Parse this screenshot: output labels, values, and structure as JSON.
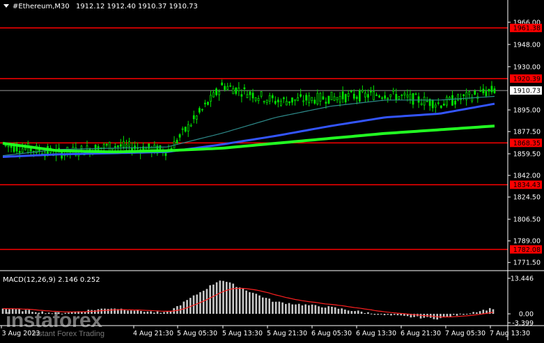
{
  "header": {
    "symbol": "#Ethereum,M30",
    "ohlc": "1912.12 1912.40 1910.37 1910.73"
  },
  "price_axis": {
    "ticks": [
      "1966.00",
      "1948.00",
      "1930.00",
      "1895.00",
      "1877.50",
      "1859.50",
      "1842.00",
      "1824.50",
      "1806.50",
      "1789.00",
      "1771.50"
    ],
    "current_price": "1910.73"
  },
  "levels": [
    "1961.38",
    "1920.39",
    "1868.35",
    "1834.43",
    "1782.08"
  ],
  "time_axis": [
    "3 Aug 2023",
    "4 Aug 21:30",
    "5 Aug 05:30",
    "5 Aug 13:30",
    "5 Aug 21:30",
    "6 Aug 05:30",
    "6 Aug 13:30",
    "6 Aug 21:30",
    "7 Aug 05:30",
    "7 Aug 13:30"
  ],
  "macd": {
    "label": "MACD(12,26,9) 2.146 0.252",
    "ticks": [
      "13.446",
      "0.00",
      "-3.399"
    ]
  },
  "watermark": {
    "name": "instaforex",
    "tagline": "Instant Forex Trading"
  },
  "colors": {
    "background": "#000000",
    "candle": "#00e000",
    "level_line": "#ff0000",
    "level_label_bg": "#ff0000",
    "ma_fast": "#2e8b8b",
    "ma_mid": "#3355ff",
    "ma_slow": "#22ff22",
    "macd_hist": "#c8c8c8",
    "macd_signal": "#ff2020",
    "axis_text": "#ffffff"
  },
  "chart_data": {
    "type": "line",
    "title": "#Ethereum,M30",
    "ylim": [
      1766,
      1975
    ],
    "x": [
      "3 Aug 2023",
      "4 Aug 21:30",
      "5 Aug 05:30",
      "5 Aug 13:30",
      "5 Aug 21:30",
      "6 Aug 05:30",
      "6 Aug 13:30",
      "6 Aug 21:30",
      "7 Aug 05:30",
      "7 Aug 13:30"
    ],
    "series": [
      {
        "values": [
          1866,
          1860,
          1866,
          1862,
          1915,
          1902,
          1905,
          1908,
          1900,
          1911
        ]
      },
      {
        "values": [
          1858,
          1863,
          1864,
          1865,
          1876,
          1889,
          1898,
          1903,
          1903,
          1906
        ]
      },
      {
        "values": [
          1857,
          1859,
          1860,
          1861,
          1867,
          1874,
          1882,
          1889,
          1892,
          1900
        ]
      },
      {
        "values": [
          1868,
          1862,
          1861,
          1862,
          1864,
          1868,
          1872,
          1876,
          1879,
          1882
        ]
      }
    ],
    "macd_histogram": [
      2.0,
      0.2,
      2.2,
      0.2,
      13.0,
      4.5,
      2.5,
      -0.5,
      -1.8,
      2.1
    ]
  }
}
